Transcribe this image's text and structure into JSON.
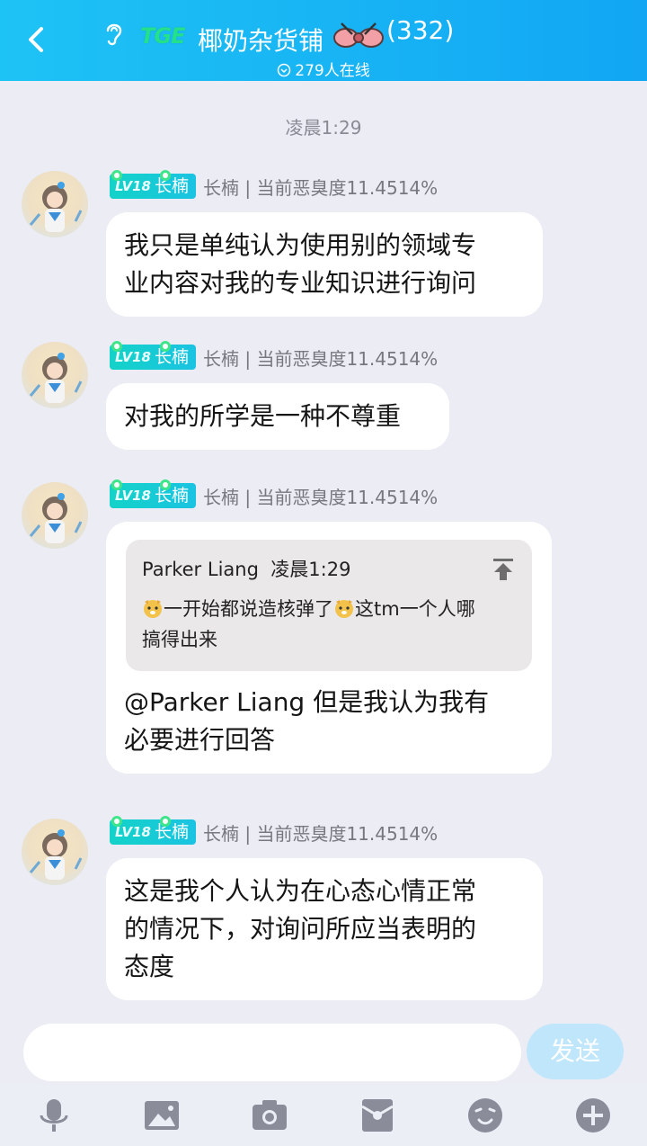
{
  "header": {
    "tag_logo": "TGE",
    "title": "椰奶杂货铺",
    "member_count": "(332)",
    "online": "279人在线",
    "bg_color": "#12a6f3"
  },
  "time_separator": "凌晨1:29",
  "messages": [
    {
      "level": "LV18",
      "badge_name": "长楠",
      "sender": "长楠 | 当前恶臭度11.4514%",
      "lines": [
        "我只是单纯认为使用别的领域专",
        "业内容对我的专业知识进行询问"
      ]
    },
    {
      "level": "LV18",
      "badge_name": "长楠",
      "sender": "长楠 | 当前恶臭度11.4514%",
      "lines": [
        "对我的所学是一种不尊重"
      ]
    },
    {
      "level": "LV18",
      "badge_name": "长楠",
      "sender": "长楠 | 当前恶臭度11.4514%",
      "quote": {
        "author": "Parker Liang",
        "time": "凌晨1:29",
        "text_a": "一开始都说造核弹了",
        "text_b": "这tm一个人哪",
        "text_c": "搞得出来"
      },
      "lines": [
        "@Parker Liang 但是我认为我有",
        "必要进行回答"
      ]
    },
    {
      "level": "LV18",
      "badge_name": "长楠",
      "sender": "长楠 | 当前恶臭度11.4514%",
      "lines": [
        "这是我个人认为在心态心情正常",
        "的情况下，对询问所应当表明的",
        "态度"
      ]
    }
  ],
  "input": {
    "placeholder": "",
    "send_label": "发送"
  },
  "toolbar": {
    "icons": [
      "microphone-icon",
      "image-icon",
      "camera-icon",
      "red-packet-icon",
      "emoji-icon",
      "plus-icon"
    ]
  }
}
